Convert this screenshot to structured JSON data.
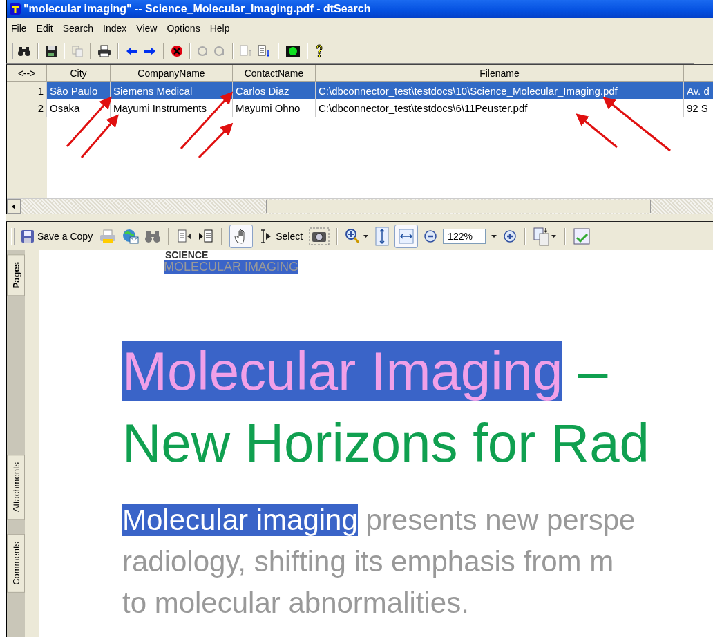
{
  "window": {
    "title": "\"molecular imaging\" -- Science_Molecular_Imaging.pdf - dtSearch"
  },
  "menu": [
    "File",
    "Edit",
    "Search",
    "Index",
    "View",
    "Options",
    "Help"
  ],
  "table": {
    "columns": [
      "<-->",
      "City",
      "CompanyName",
      "ContactName",
      "Filename",
      ""
    ],
    "rows": [
      {
        "selected": true,
        "cells": [
          "1",
          "São Paulo",
          "Siemens Medical",
          "Carlos Diaz",
          "C:\\dbconnector_test\\testdocs\\10\\Science_Molecular_Imaging.pdf",
          "Av. d"
        ]
      },
      {
        "selected": false,
        "cells": [
          "2",
          "Osaka",
          "Mayumi Instruments",
          "Mayumi Ohno",
          "C:\\dbconnector_test\\testdocs\\6\\11Peuster.pdf",
          "92 S"
        ]
      }
    ]
  },
  "pdf_toolbar": {
    "save_label": "Save a Copy",
    "select_label": "Select",
    "zoom": "122%",
    "hand_selected": true,
    "fit_width_selected": true
  },
  "side_tabs": [
    {
      "label": "Pages",
      "selected": true
    },
    {
      "label": "Attachments",
      "selected": false
    },
    {
      "label": "Comments",
      "selected": false
    }
  ],
  "pdf": {
    "kicker": "SCIENCE",
    "section": {
      "text": "MOLECULAR IMAGING",
      "highlighted": true
    },
    "heading_lines": [
      [
        {
          "text": "Molecular Imaging",
          "highlighted": true
        },
        {
          "text": " –",
          "highlighted": false
        }
      ],
      [
        {
          "text": "New Horizons for Rad",
          "highlighted": false
        }
      ]
    ],
    "body_lines": [
      [
        {
          "text": "Molecular imaging",
          "highlighted": true
        },
        {
          "text": " presents new perspe",
          "highlighted": false
        }
      ],
      [
        {
          "text": "radiology, shifting its emphasis from m",
          "highlighted": false
        }
      ],
      [
        {
          "text": "to molecular abnormalities.",
          "highlighted": false
        }
      ]
    ]
  }
}
